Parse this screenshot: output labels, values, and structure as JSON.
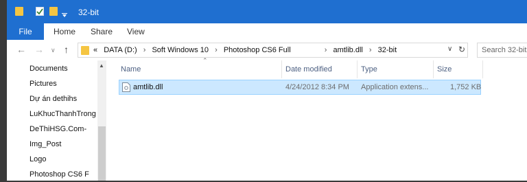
{
  "window": {
    "title": "32-bit"
  },
  "ribbon": {
    "file": "File",
    "home": "Home",
    "share": "Share",
    "view": "View"
  },
  "address": {
    "overflow": "«",
    "crumbs": [
      "DATA (D:)",
      "Soft Windows 10",
      "Photoshop CS6 Full",
      "amtlib.dll",
      "32-bit"
    ]
  },
  "search": {
    "placeholder": "Search 32-bit"
  },
  "nav_pane": {
    "items": [
      {
        "label": "Documents",
        "icon": "documents-icon",
        "pinned": true
      },
      {
        "label": "Pictures",
        "icon": "pictures-icon",
        "pinned": true
      },
      {
        "label": "Dự án dethihs",
        "icon": "folder-icon",
        "pinned": true
      },
      {
        "label": "LuKhucThanhTrong",
        "icon": "folder-icon",
        "pinned": true
      },
      {
        "label": "DeThiHSG.Com-",
        "icon": "folder-icon",
        "pinned": false
      },
      {
        "label": "Img_Post",
        "icon": "folder-check-icon",
        "pinned": false
      },
      {
        "label": "Logo",
        "icon": "folder-check-icon",
        "pinned": false
      },
      {
        "label": "Photoshop CS6 F",
        "icon": "folder-icon",
        "pinned": false
      }
    ]
  },
  "columns": {
    "name": "Name",
    "date": "Date modified",
    "type": "Type",
    "size": "Size"
  },
  "files": [
    {
      "name": "amtlib.dll",
      "date": "4/24/2012 8:34 PM",
      "type": "Application extens...",
      "size": "1,752 KB",
      "selected": true
    }
  ],
  "colors": {
    "accent": "#1f6fd0",
    "selection": "#cce8ff",
    "folder": "#f5c542"
  }
}
